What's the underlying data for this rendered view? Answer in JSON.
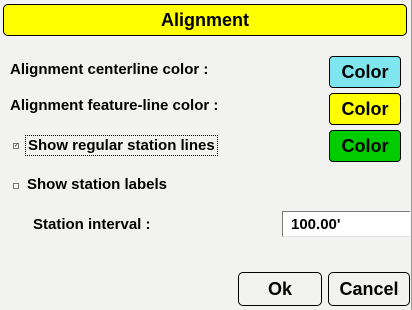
{
  "dialog": {
    "title": "Alignment"
  },
  "rows": {
    "centerline_label": "Alignment centerline color :",
    "featureline_label": "Alignment feature-line color :",
    "station_lines_label": "Show regular station lines",
    "station_labels_label": "Show station labels",
    "station_interval_label": "Station interval :"
  },
  "buttons": {
    "centerline_color": {
      "label": "Color",
      "color": "#7fe6f0"
    },
    "featureline_color": {
      "label": "Color",
      "color": "#ffff00"
    },
    "station_lines_color": {
      "label": "Color",
      "color": "#00cc00"
    },
    "ok": "Ok",
    "cancel": "Cancel"
  },
  "checkboxes": {
    "show_station_lines": {
      "checked": true,
      "mark": "✓"
    },
    "show_station_labels": {
      "checked": false,
      "mark": ""
    }
  },
  "inputs": {
    "station_interval": "100.00'"
  }
}
